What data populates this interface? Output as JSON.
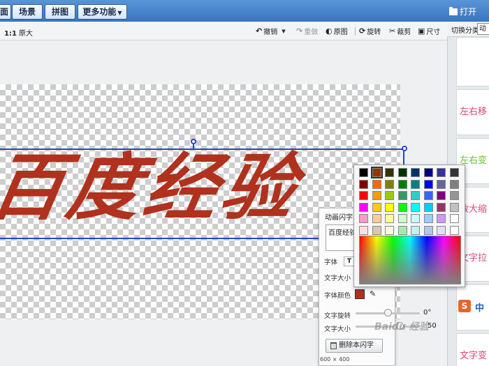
{
  "tabs": [
    {
      "label": "面"
    },
    {
      "label": "场景"
    },
    {
      "label": "拼图"
    },
    {
      "label": "更多功能"
    }
  ],
  "open_label": "打开",
  "toolbar": {
    "zoom_ratio": "1:1",
    "zoom_label": "原大",
    "undo": "撤销",
    "redo": "重做",
    "original": "原图",
    "rotate": "旋转",
    "crop": "裁剪",
    "size": "尺寸"
  },
  "category": {
    "label": "切换分类",
    "active_tab": "动"
  },
  "effects": [
    {
      "label": "",
      "color": "#ffffff"
    },
    {
      "label": "左右移",
      "color": "#e0457b"
    },
    {
      "label": "左右变",
      "color": "#6abf3a"
    },
    {
      "label": "放大缩",
      "color": "#e0457b"
    },
    {
      "label": "文字拉",
      "color": "#e0457b"
    },
    {
      "label": "",
      "color": "#ffffff"
    },
    {
      "label": "文字变",
      "color": "#e0457b"
    }
  ],
  "canvas_text": "百度经验",
  "anim_panel": {
    "title": "动画闪字",
    "input_value": "百度经验",
    "font_label": "字体",
    "text_size_label": "文字大小",
    "font_color_label": "字体颜色",
    "rotation_label": "文字旋转",
    "rotation_value": "0°",
    "size_label": "文字大小",
    "size_value": "50",
    "size_slider_fraction": 0.72,
    "rotation_slider_fraction": 0.5,
    "delete_label": "删除本闪字",
    "dimensions_text": "600 × 400",
    "font_color": "#b0311d"
  },
  "palette": {
    "rows": [
      [
        "#000000",
        "#993300",
        "#333300",
        "#003300",
        "#003366",
        "#000080",
        "#333399",
        "#333333"
      ],
      [
        "#800000",
        "#ff6600",
        "#808000",
        "#008000",
        "#008080",
        "#0000ff",
        "#666699",
        "#808080"
      ],
      [
        "#ff0000",
        "#ff9900",
        "#99cc00",
        "#339966",
        "#33cccc",
        "#3366ff",
        "#800080",
        "#969696"
      ],
      [
        "#ff00ff",
        "#ffcc00",
        "#ffff00",
        "#00ff00",
        "#00ffff",
        "#00ccff",
        "#993366",
        "#c0c0c0"
      ],
      [
        "#ff99cc",
        "#ffcc99",
        "#ffff99",
        "#ccffcc",
        "#ccffff",
        "#99ccff",
        "#cc99ff",
        "#ffffff"
      ],
      [
        "#ffe0e0",
        "#d8c8b0",
        "#fff8e0",
        "#a8e8b0",
        "#c0f0f0",
        "#b0c8e8",
        "#e0e0f8",
        "#ffffff"
      ]
    ],
    "selected": [
      0,
      1
    ]
  },
  "watermark_text": "Baidu 经验",
  "sogou_text": "中"
}
